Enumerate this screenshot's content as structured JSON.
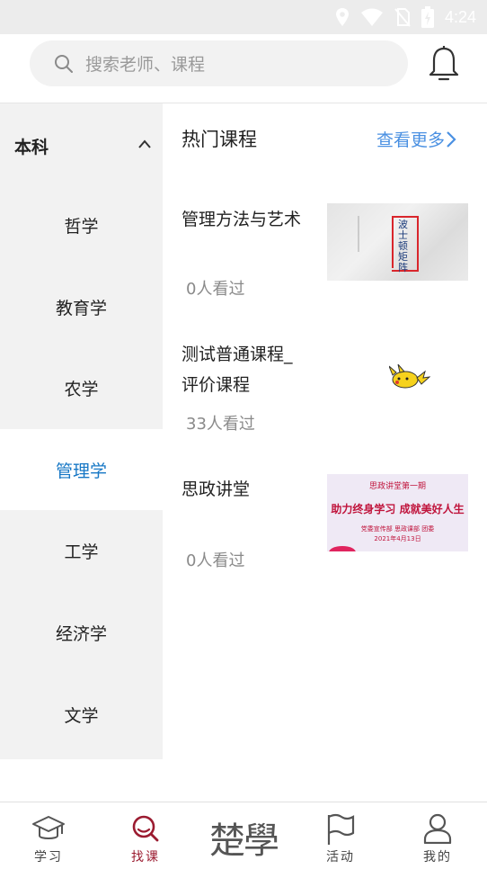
{
  "status_bar": {
    "time": "4:24"
  },
  "search": {
    "placeholder": "搜索老师、课程"
  },
  "sidebar": {
    "section_label": "本科",
    "items": [
      {
        "label": "哲学",
        "active": false
      },
      {
        "label": "教育学",
        "active": false
      },
      {
        "label": "农学",
        "active": false
      },
      {
        "label": "管理学",
        "active": true
      },
      {
        "label": "工学",
        "active": false
      },
      {
        "label": "经济学",
        "active": false
      },
      {
        "label": "文学",
        "active": false
      }
    ]
  },
  "main": {
    "section_title": "热门课程",
    "more_label": "查看更多",
    "courses": [
      {
        "title": "管理方法与艺术",
        "views": "0人看过",
        "thumb_text": "波士顿矩阵"
      },
      {
        "title_line1": "测试普通课程_",
        "title_line2": "评价课程",
        "views": "33人看过"
      },
      {
        "title": "思政讲堂",
        "views": "0人看过",
        "thumb_line1": "思政讲堂第一期",
        "thumb_line2": "助力终身学习 成就美好人生",
        "thumb_line3": "党委宣传部 思政课部 团委",
        "thumb_line4": "2021年4月13日"
      }
    ]
  },
  "tabbar": {
    "tabs": [
      {
        "label": "学习",
        "icon": "graduation-cap-icon",
        "active": false
      },
      {
        "label": "找课",
        "icon": "search-course-icon",
        "active": true
      },
      {
        "label": "楚學",
        "icon": "brand-logo",
        "active": false
      },
      {
        "label": "活动",
        "icon": "flag-icon",
        "active": false
      },
      {
        "label": "我的",
        "icon": "person-icon",
        "active": false
      }
    ]
  },
  "colors": {
    "accent_blue": "#1677c5",
    "link_blue": "#4a90e2",
    "active_tab": "#9b1b30",
    "sidebar_bg": "#f2f2f2"
  }
}
